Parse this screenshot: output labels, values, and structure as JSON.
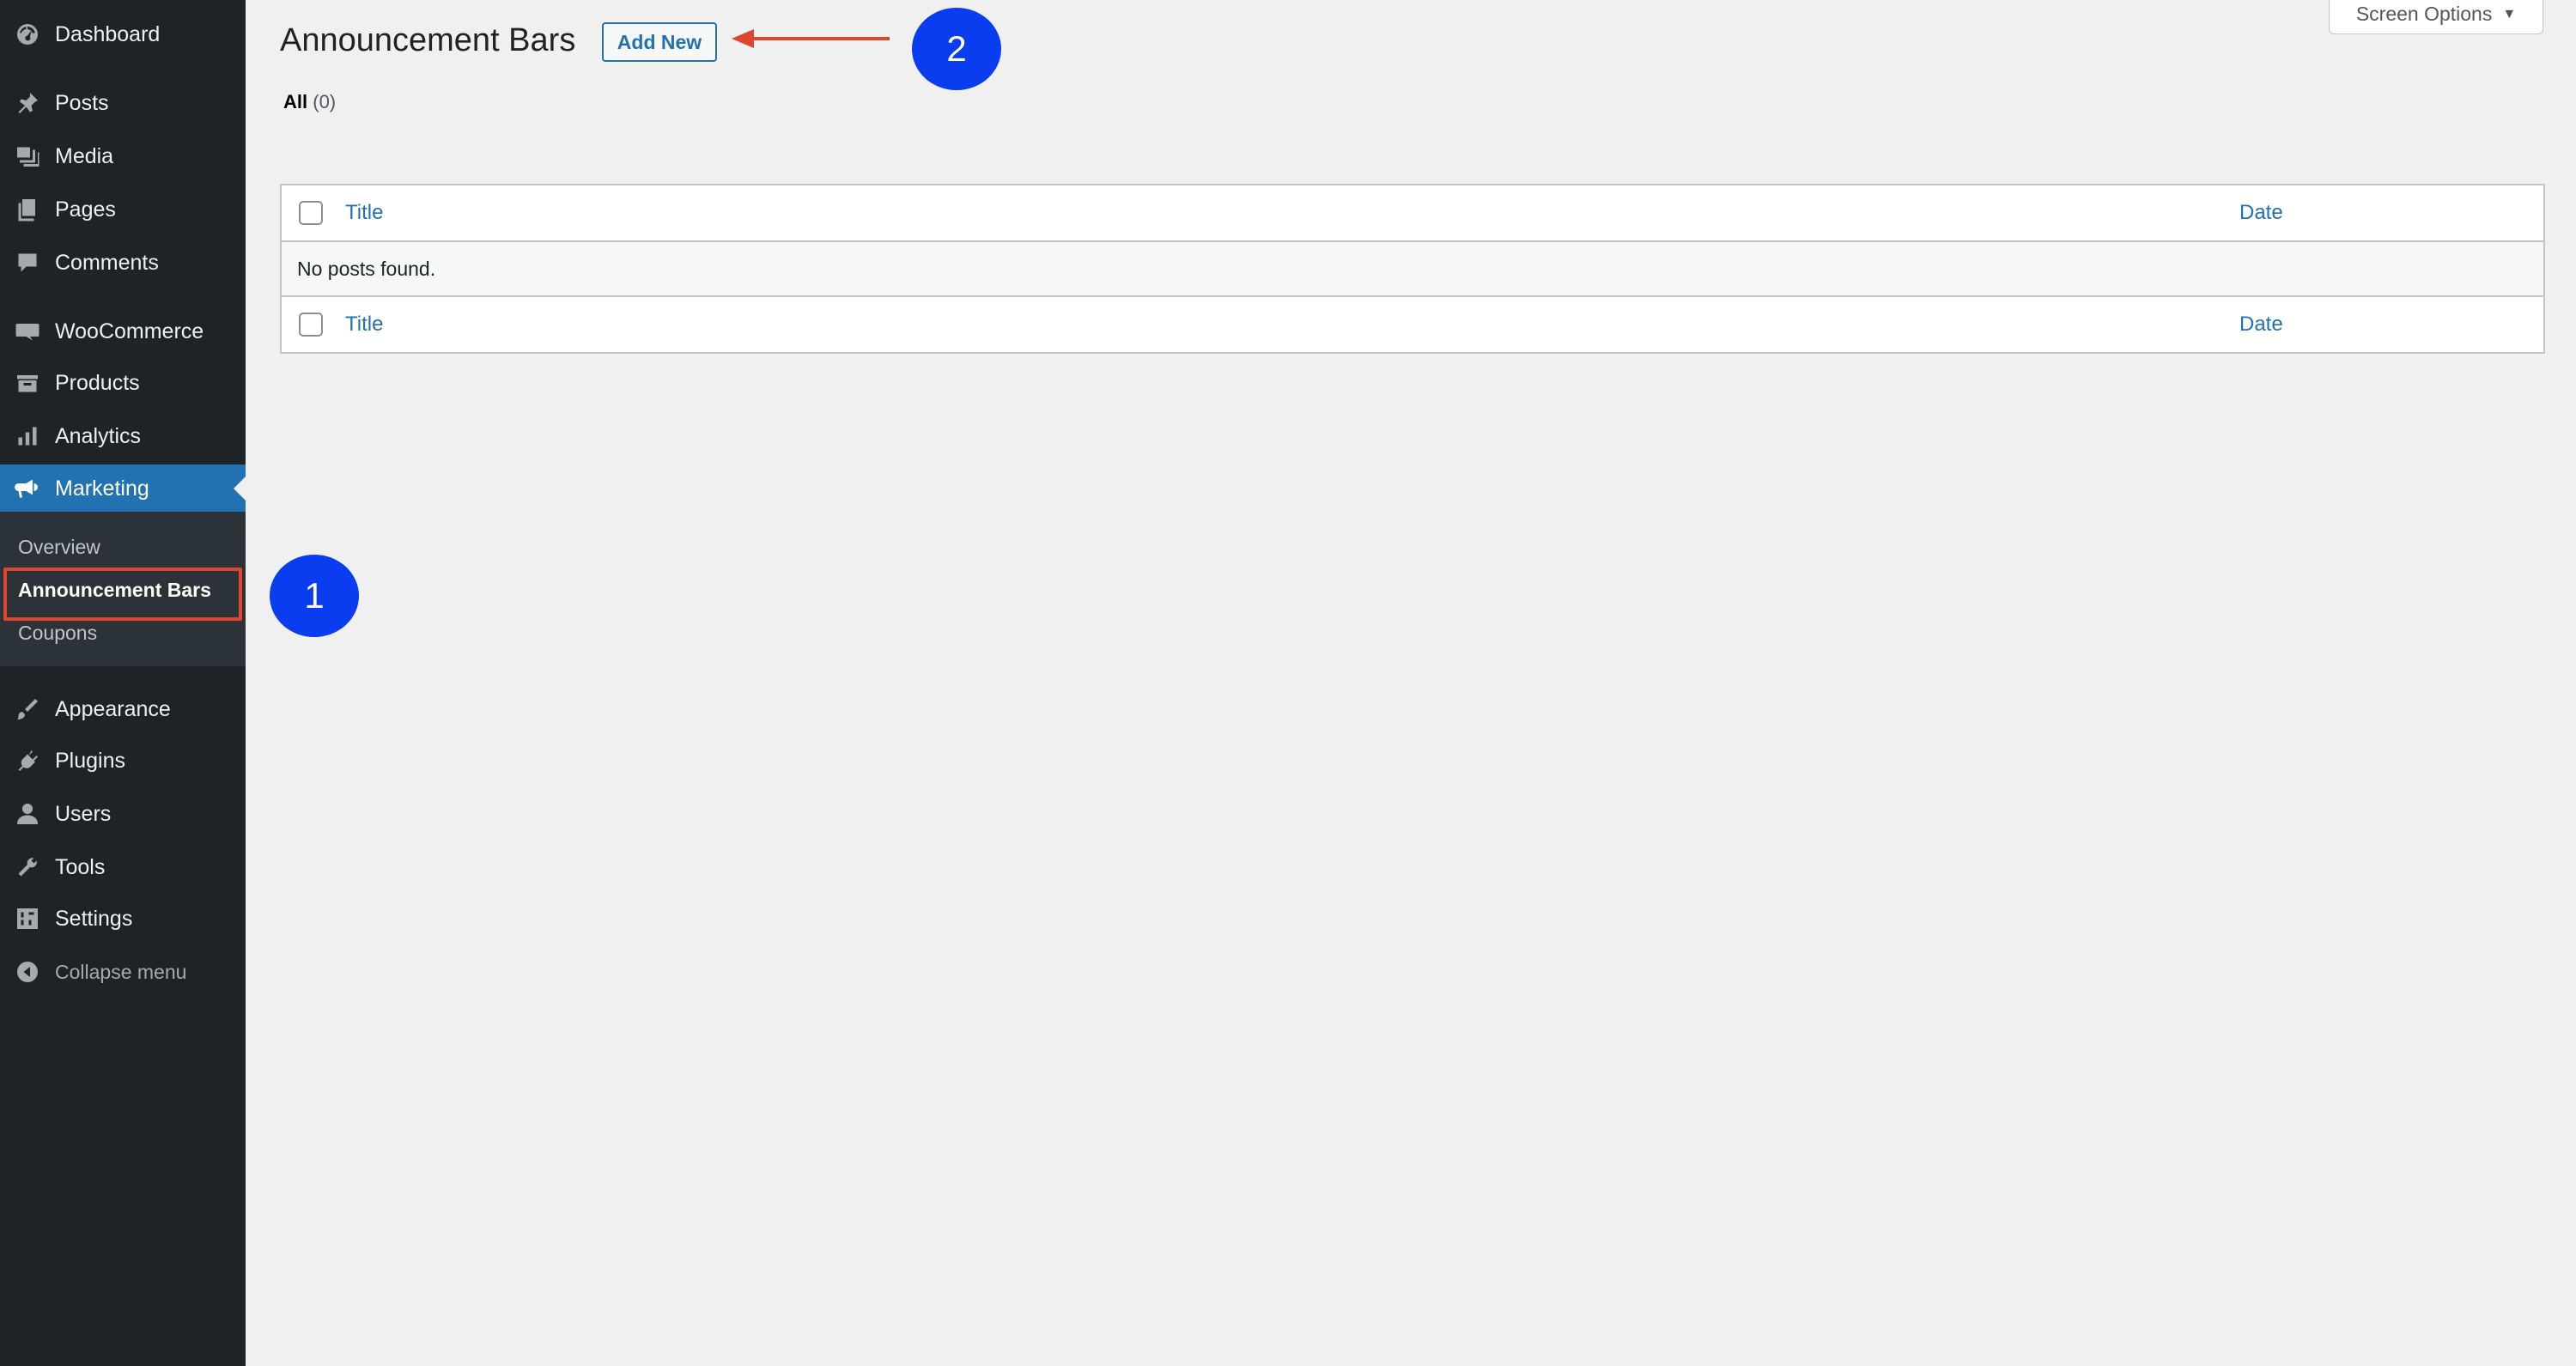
{
  "sidebar": {
    "items": [
      {
        "label": "Dashboard",
        "icon": "dashboard-icon"
      },
      {
        "label": "Posts",
        "icon": "pin-icon"
      },
      {
        "label": "Media",
        "icon": "media-icon"
      },
      {
        "label": "Pages",
        "icon": "pages-icon"
      },
      {
        "label": "Comments",
        "icon": "comment-icon"
      },
      {
        "label": "WooCommerce",
        "icon": "woocommerce-icon"
      },
      {
        "label": "Products",
        "icon": "products-icon"
      },
      {
        "label": "Analytics",
        "icon": "analytics-icon"
      },
      {
        "label": "Marketing",
        "icon": "megaphone-icon"
      },
      {
        "label": "Appearance",
        "icon": "brush-icon"
      },
      {
        "label": "Plugins",
        "icon": "plugin-icon"
      },
      {
        "label": "Users",
        "icon": "user-icon"
      },
      {
        "label": "Tools",
        "icon": "wrench-icon"
      },
      {
        "label": "Settings",
        "icon": "settings-icon"
      }
    ],
    "submenu": [
      "Overview",
      "Announcement Bars",
      "Coupons"
    ],
    "collapse_label": "Collapse menu"
  },
  "header": {
    "title": "Announcement Bars",
    "add_new_label": "Add New",
    "screen_options_label": "Screen Options"
  },
  "filter": {
    "all_label": "All",
    "all_count": "(0)"
  },
  "table": {
    "columns": [
      "Title",
      "Date"
    ],
    "empty_message": "No posts found."
  },
  "annotations": {
    "marker_1": "1",
    "marker_2": "2"
  },
  "colors": {
    "sidebar_bg": "#1d2327",
    "accent": "#2271b1",
    "marker": "#0a3cf0",
    "highlight": "#e0452f"
  }
}
